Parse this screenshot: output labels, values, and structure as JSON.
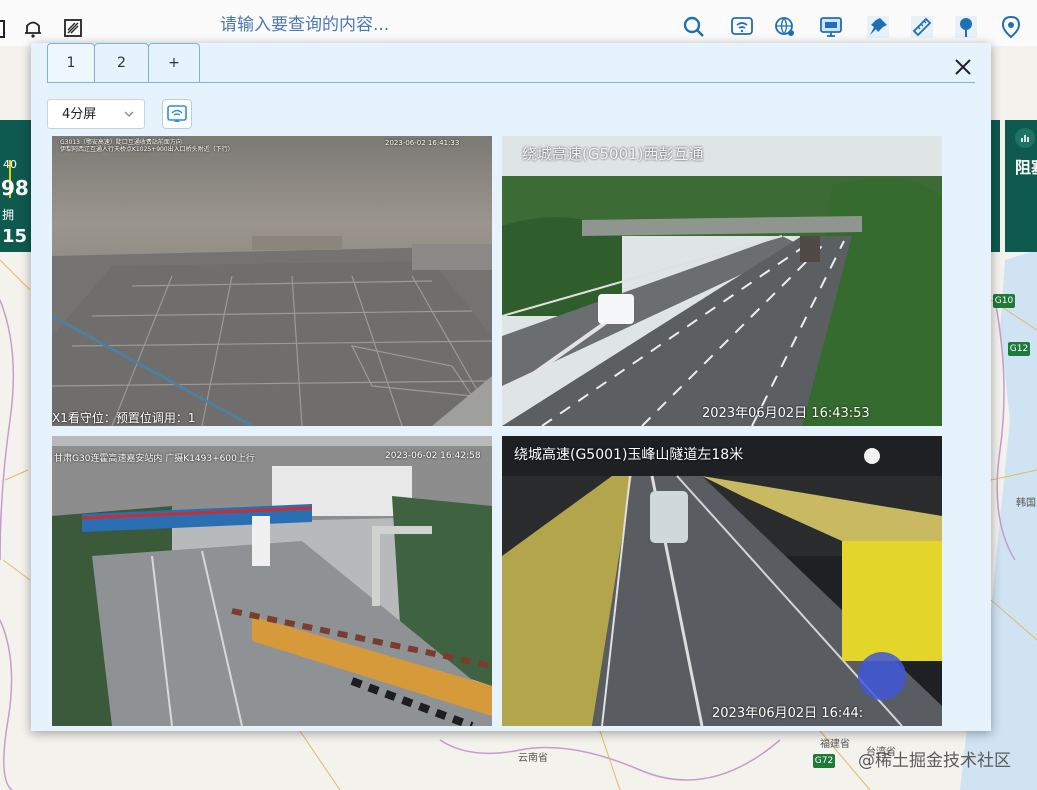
{
  "topbar": {
    "search_placeholder": "请输入要查询的内容...",
    "icons": [
      "bell-icon",
      "grid-icon",
      "search-icon",
      "wifi-cast-icon",
      "globe-pin-icon",
      "monitor-icon",
      "pin-icon",
      "ruler-icon",
      "location-icon",
      "marker-icon"
    ]
  },
  "left_panel": {
    "t1": "40",
    "t2": "98",
    "t3": "拥",
    "t4": "15"
  },
  "right_panel": {
    "label": "阻塞"
  },
  "map": {
    "labels": [
      "韩国",
      "云南省",
      "福建省",
      "台湾省",
      "福建省"
    ],
    "roads": [
      "G10",
      "G12",
      "G72"
    ]
  },
  "dialog": {
    "tabs": [
      {
        "label": "1",
        "active": true
      },
      {
        "label": "2",
        "active": false
      },
      {
        "label": "+",
        "active": false
      }
    ],
    "screen_select": "4分屏",
    "videos": [
      {
        "title_line1": "G3013（鄂安高速）陡口互通收费站前面方向",
        "title_line2": "伊犁阿西辽互通人行天桥点K1025+900出入口桥头附近（下行）",
        "timestamp": "2023-06-02 16:41:33",
        "bottom": "X1看守位：预置位调用：1"
      },
      {
        "title": "绕城高速(G5001)西彭互通",
        "timestamp": "2023年06月02日  16:43:53"
      },
      {
        "title": "甘肃G30连霍高速嘉安站内 广摄K1493+600上行",
        "timestamp": "2023-06-02 16:42:58"
      },
      {
        "title": "绕城高速(G5001)玉峰山隧道左18米",
        "timestamp": "2023年06月02日  16:44:"
      }
    ]
  },
  "watermark": "@稀土掘金技术社区",
  "colors": {
    "panel": "#0e5a4f",
    "dialog_bg": "#e7f3fc",
    "tab_border": "#7bb4dc",
    "accent": "#1f7fd1"
  }
}
